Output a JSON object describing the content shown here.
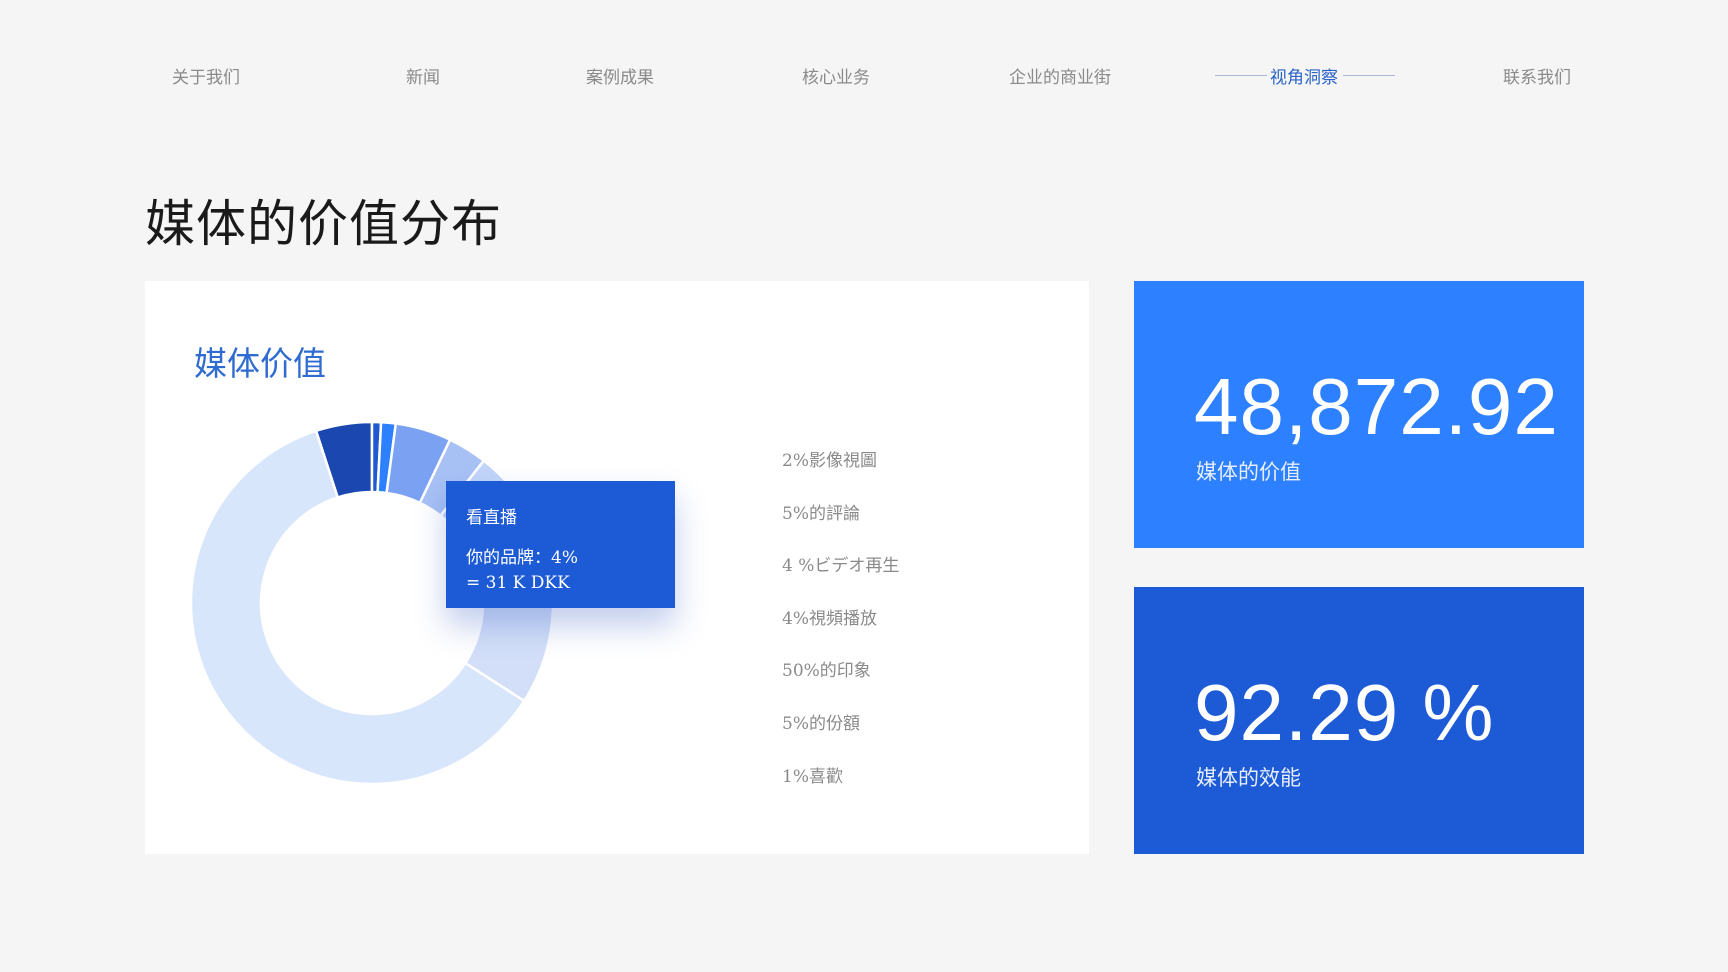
{
  "nav": {
    "items": [
      {
        "label": "关于我们"
      },
      {
        "label": "新闻"
      },
      {
        "label": "案例成果"
      },
      {
        "label": "核心业务"
      },
      {
        "label": "企业的商业街"
      },
      {
        "label": "视角洞察",
        "active": true
      },
      {
        "label": "联系我们"
      }
    ]
  },
  "page": {
    "title": "媒体的价值分布"
  },
  "chart_card": {
    "title": "媒体价值",
    "tooltip": {
      "title": "看直播",
      "line1": "你的品牌：4%",
      "line2": "= 31 K DKK"
    },
    "legend": [
      "2%影像視圖",
      "5%的評論",
      "4 %ビデオ再生",
      "4%視頻播放",
      "50%的印象",
      "5%的份額",
      "1%喜歡"
    ]
  },
  "chart_data": {
    "type": "pie",
    "variant": "donut",
    "segments": [
      {
        "value": 5,
        "color": "#1a47b0"
      },
      {
        "value": 0.8,
        "color": "#2158d0"
      },
      {
        "value": 1.3,
        "color": "#2d80ff"
      },
      {
        "value": 5,
        "color": "#7ba2f2"
      },
      {
        "value": 3.5,
        "color": "#a8c1f5"
      },
      {
        "value": 3.5,
        "color": "#c2d4f8"
      },
      {
        "value": 20,
        "color": "#d3dff8"
      },
      {
        "value": 60.9,
        "color": "#d8e6fc"
      }
    ]
  },
  "kpis": [
    {
      "value": "48,872.92",
      "label": "媒体的价值"
    },
    {
      "value": "92.29 %",
      "label": "媒体的效能"
    }
  ],
  "colors": {
    "background": "#f5f5f5",
    "accent": "#2d80ff",
    "accent_dark": "#1d5ad6",
    "nav_active": "#2b64c8"
  }
}
